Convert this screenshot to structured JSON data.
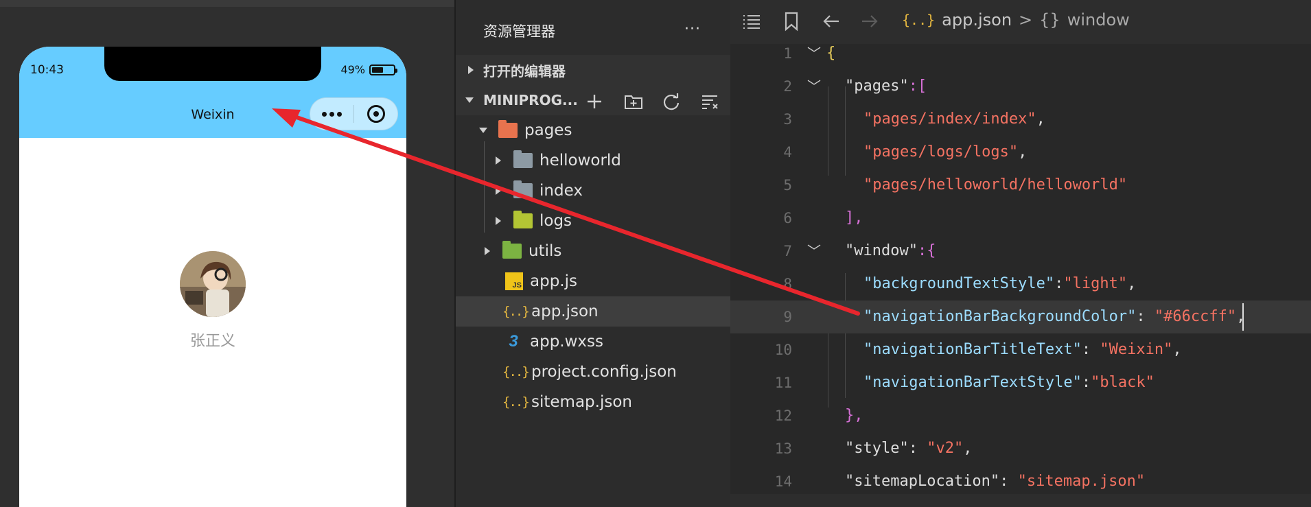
{
  "simulator": {
    "time": "10:43",
    "battery": "49%",
    "nav_title": "Weixin",
    "nav_bg_color": "#66ccff",
    "username": "张正义"
  },
  "explorer": {
    "title": "资源管理器",
    "more": "···",
    "open_editors": "打开的编辑器",
    "project_name": "MINIPROG...",
    "tree": [
      {
        "label": "pages"
      },
      {
        "label": "helloworld"
      },
      {
        "label": "index"
      },
      {
        "label": "logs"
      },
      {
        "label": "utils"
      },
      {
        "label": "app.js"
      },
      {
        "label": "app.json"
      },
      {
        "label": "app.wxss"
      },
      {
        "label": "project.config.json"
      },
      {
        "label": "sitemap.json"
      }
    ]
  },
  "editor": {
    "breadcrumb_file": "app.json",
    "breadcrumb_symbol": "window",
    "breadcrumb_sep": ">",
    "json_icon": "{..}",
    "obj_icon": "{}",
    "lines": [
      {
        "n": "1",
        "a": "{",
        "b": "",
        "c": "",
        "d": ""
      },
      {
        "n": "2",
        "a": "\"pages\"",
        "b": ":[",
        "c": "",
        "d": ""
      },
      {
        "n": "3",
        "a": "\"pages/index/index\"",
        "b": ",",
        "c": "",
        "d": ""
      },
      {
        "n": "4",
        "a": "\"pages/logs/logs\"",
        "b": ",",
        "c": "",
        "d": ""
      },
      {
        "n": "5",
        "a": "\"pages/helloworld/helloworld\"",
        "b": "",
        "c": "",
        "d": ""
      },
      {
        "n": "6",
        "a": "],",
        "b": "",
        "c": "",
        "d": ""
      },
      {
        "n": "7",
        "a": "\"window\"",
        "b": ":{",
        "c": "",
        "d": ""
      },
      {
        "n": "8",
        "a": "\"backgroundTextStyle\"",
        "b": ":",
        "c": "\"light\"",
        "d": ","
      },
      {
        "n": "9",
        "a": "\"navigationBarBackgroundColor\"",
        "b": ": ",
        "c": "\"#66ccff\"",
        "d": ","
      },
      {
        "n": "10",
        "a": "\"navigationBarTitleText\"",
        "b": ": ",
        "c": "\"Weixin\"",
        "d": ","
      },
      {
        "n": "11",
        "a": "\"navigationBarTextStyle\"",
        "b": ":",
        "c": "\"black\"",
        "d": ""
      },
      {
        "n": "12",
        "a": "},",
        "b": "",
        "c": "",
        "d": ""
      },
      {
        "n": "13",
        "a": "\"style\"",
        "b": ": ",
        "c": "\"v2\"",
        "d": ","
      },
      {
        "n": "14",
        "a": "\"sitemapLocation\"",
        "b": ": ",
        "c": "\"sitemap.json\"",
        "d": ""
      }
    ]
  },
  "colors": {
    "accent_arrow": "#e8262d",
    "key": "#9cdcfe",
    "string": "#f47262"
  }
}
